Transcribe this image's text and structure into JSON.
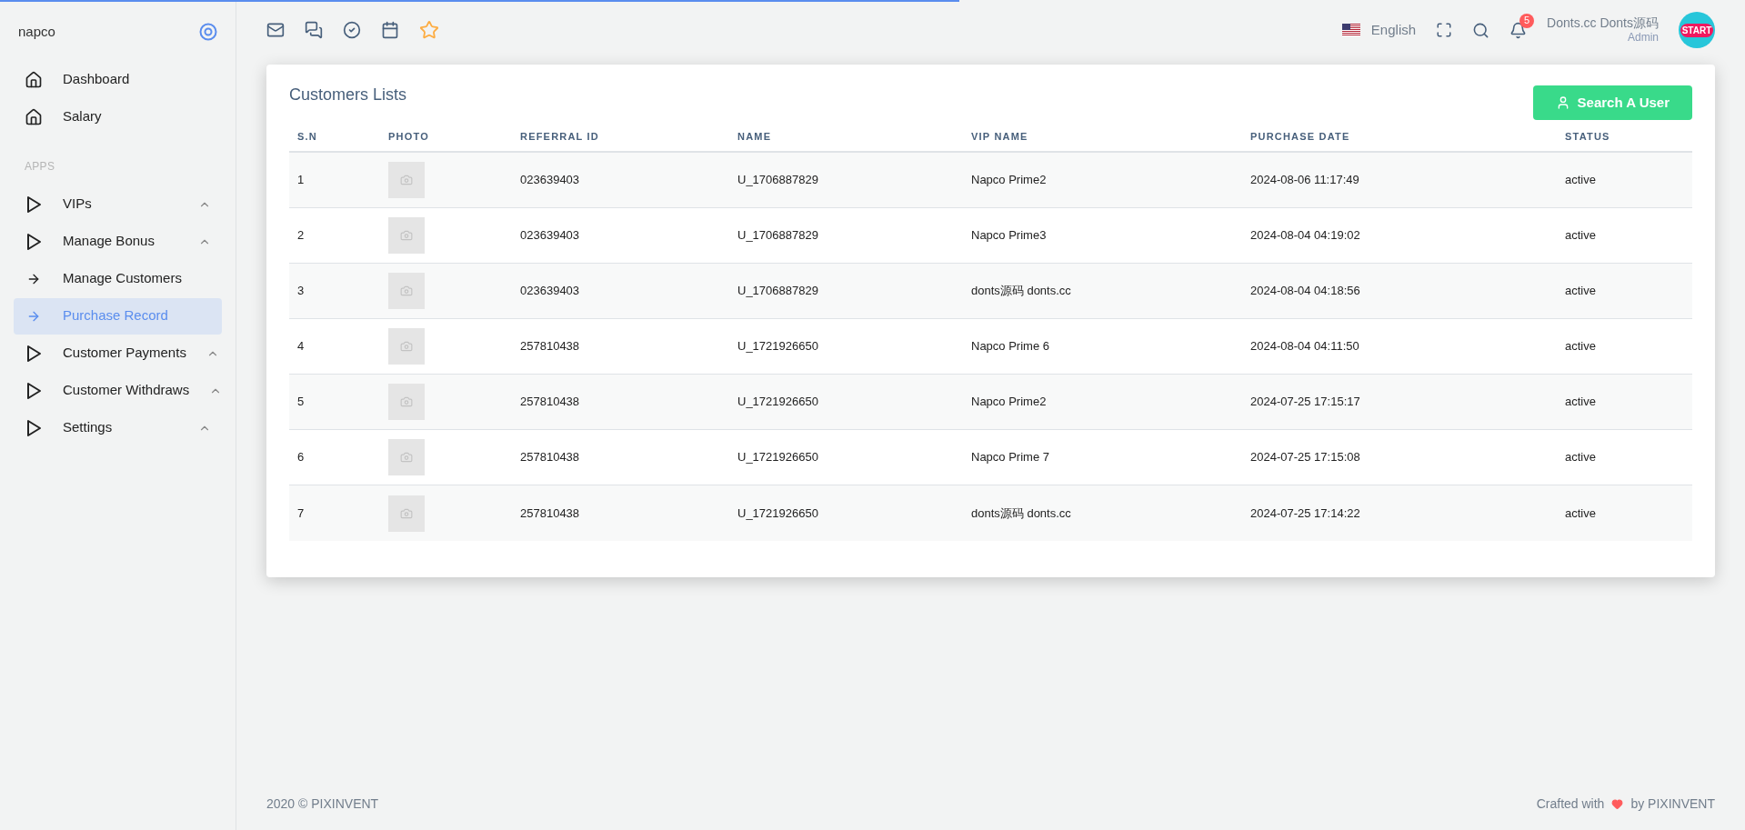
{
  "top_loader": {
    "level": 0.55
  },
  "sidebar": {
    "brand": "napco",
    "items": [
      {
        "kind": "link",
        "label": "Dashboard",
        "selected": false
      },
      {
        "kind": "link",
        "label": "Salary",
        "selected": false
      },
      {
        "kind": "header",
        "label": "APPS"
      },
      {
        "kind": "group",
        "label": "VIPs",
        "selected": false
      },
      {
        "kind": "group",
        "label": "Manage Bonus",
        "selected": false
      },
      {
        "kind": "sub",
        "label": "Manage Customers",
        "selected": false
      },
      {
        "kind": "sub",
        "label": "Purchase Record",
        "selected": true
      },
      {
        "kind": "group",
        "label": "Customer Payments",
        "selected": false
      },
      {
        "kind": "group",
        "label": "Customer Withdraws",
        "selected": false
      },
      {
        "kind": "group",
        "label": "Settings",
        "selected": false
      }
    ]
  },
  "topbar": {
    "language": "English",
    "notifications": "5",
    "user_name": "Donts.cc Donts源码",
    "user_role": "Admin",
    "avatar_text": "START"
  },
  "card": {
    "title": "Customers Lists",
    "button": "Search A User",
    "columns": [
      "S.N",
      "PHOTO",
      "REFERRAL ID",
      "NAME",
      "VIP NAME",
      "PURCHASE DATE",
      "STATUS"
    ],
    "rows": [
      [
        "1",
        "",
        "023639403",
        "U_1706887829",
        "Napco Prime2",
        "2024-08-06 11:17:49",
        "active"
      ],
      [
        "2",
        "",
        "023639403",
        "U_1706887829",
        "Napco Prime3",
        "2024-08-04 04:19:02",
        "active"
      ],
      [
        "3",
        "",
        "023639403",
        "U_1706887829",
        "donts源码 donts.cc",
        "2024-08-04 04:18:56",
        "active"
      ],
      [
        "4",
        "",
        "257810438",
        "U_1721926650",
        "Napco Prime 6",
        "2024-08-04 04:11:50",
        "active"
      ],
      [
        "5",
        "",
        "257810438",
        "U_1721926650",
        "Napco Prime2",
        "2024-07-25 17:15:17",
        "active"
      ],
      [
        "6",
        "",
        "257810438",
        "U_1721926650",
        "Napco Prime 7",
        "2024-07-25 17:15:08",
        "active"
      ],
      [
        "7",
        "",
        "257810438",
        "U_1721926650",
        "donts源码 donts.cc",
        "2024-07-25 17:14:22",
        "active"
      ]
    ]
  },
  "footer": {
    "left": "2020 © PIXINVENT",
    "right_before": "Crafted with",
    "right_after": "by PIXINVENT"
  }
}
